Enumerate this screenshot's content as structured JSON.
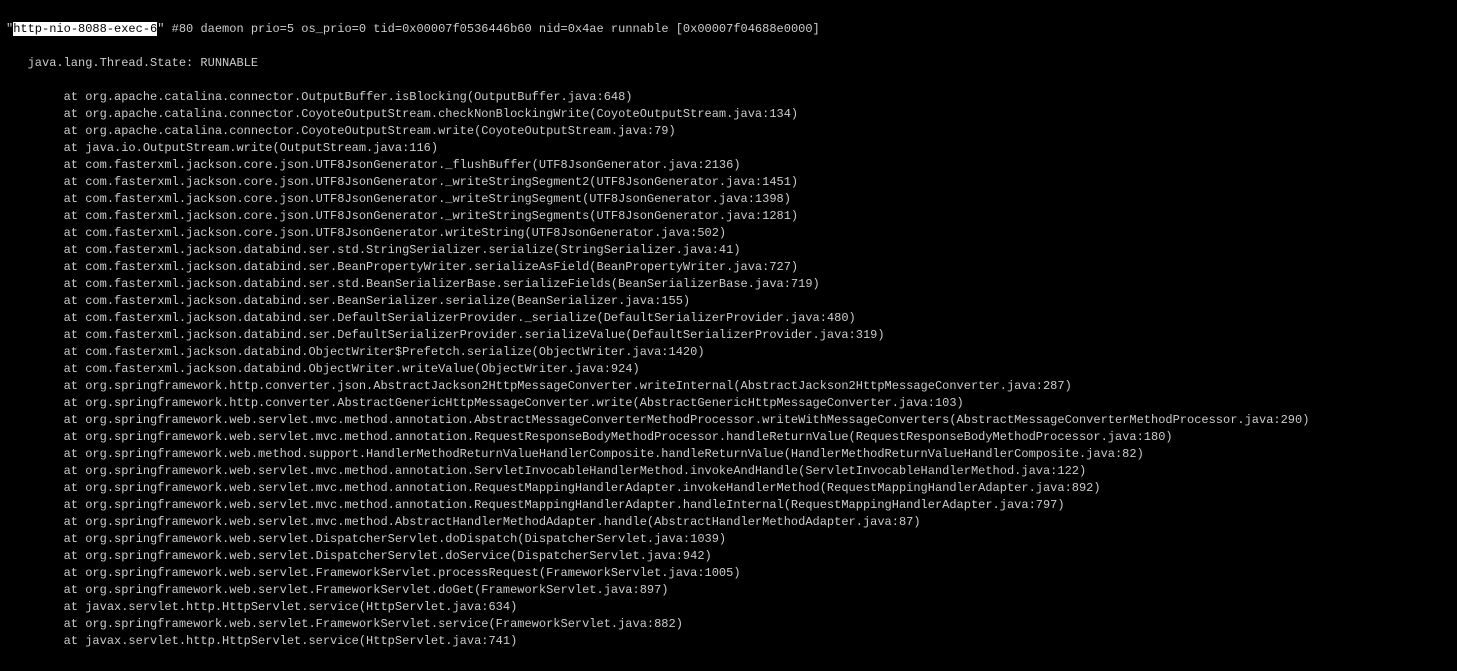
{
  "thread": {
    "quote_open": "\"",
    "name": "http-nio-8088-exec-6",
    "quote_close": "\"",
    "info": " #80 daemon prio=5 os_prio=0 tid=0x00007f0536446b60 nid=0x4ae runnable [0x00007f04688e0000]",
    "state_line": "   java.lang.Thread.State: RUNNABLE"
  },
  "frames": [
    "        at org.apache.catalina.connector.OutputBuffer.isBlocking(OutputBuffer.java:648)",
    "        at org.apache.catalina.connector.CoyoteOutputStream.checkNonBlockingWrite(CoyoteOutputStream.java:134)",
    "        at org.apache.catalina.connector.CoyoteOutputStream.write(CoyoteOutputStream.java:79)",
    "        at java.io.OutputStream.write(OutputStream.java:116)",
    "        at com.fasterxml.jackson.core.json.UTF8JsonGenerator._flushBuffer(UTF8JsonGenerator.java:2136)",
    "        at com.fasterxml.jackson.core.json.UTF8JsonGenerator._writeStringSegment2(UTF8JsonGenerator.java:1451)",
    "        at com.fasterxml.jackson.core.json.UTF8JsonGenerator._writeStringSegment(UTF8JsonGenerator.java:1398)",
    "        at com.fasterxml.jackson.core.json.UTF8JsonGenerator._writeStringSegments(UTF8JsonGenerator.java:1281)",
    "        at com.fasterxml.jackson.core.json.UTF8JsonGenerator.writeString(UTF8JsonGenerator.java:502)",
    "        at com.fasterxml.jackson.databind.ser.std.StringSerializer.serialize(StringSerializer.java:41)",
    "        at com.fasterxml.jackson.databind.ser.BeanPropertyWriter.serializeAsField(BeanPropertyWriter.java:727)",
    "        at com.fasterxml.jackson.databind.ser.std.BeanSerializerBase.serializeFields(BeanSerializerBase.java:719)",
    "        at com.fasterxml.jackson.databind.ser.BeanSerializer.serialize(BeanSerializer.java:155)",
    "        at com.fasterxml.jackson.databind.ser.DefaultSerializerProvider._serialize(DefaultSerializerProvider.java:480)",
    "        at com.fasterxml.jackson.databind.ser.DefaultSerializerProvider.serializeValue(DefaultSerializerProvider.java:319)",
    "        at com.fasterxml.jackson.databind.ObjectWriter$Prefetch.serialize(ObjectWriter.java:1420)",
    "        at com.fasterxml.jackson.databind.ObjectWriter.writeValue(ObjectWriter.java:924)",
    "        at org.springframework.http.converter.json.AbstractJackson2HttpMessageConverter.writeInternal(AbstractJackson2HttpMessageConverter.java:287)",
    "        at org.springframework.http.converter.AbstractGenericHttpMessageConverter.write(AbstractGenericHttpMessageConverter.java:103)",
    "        at org.springframework.web.servlet.mvc.method.annotation.AbstractMessageConverterMethodProcessor.writeWithMessageConverters(AbstractMessageConverterMethodProcessor.java:290)",
    "        at org.springframework.web.servlet.mvc.method.annotation.RequestResponseBodyMethodProcessor.handleReturnValue(RequestResponseBodyMethodProcessor.java:180)",
    "        at org.springframework.web.method.support.HandlerMethodReturnValueHandlerComposite.handleReturnValue(HandlerMethodReturnValueHandlerComposite.java:82)",
    "        at org.springframework.web.servlet.mvc.method.annotation.ServletInvocableHandlerMethod.invokeAndHandle(ServletInvocableHandlerMethod.java:122)",
    "        at org.springframework.web.servlet.mvc.method.annotation.RequestMappingHandlerAdapter.invokeHandlerMethod(RequestMappingHandlerAdapter.java:892)",
    "        at org.springframework.web.servlet.mvc.method.annotation.RequestMappingHandlerAdapter.handleInternal(RequestMappingHandlerAdapter.java:797)",
    "        at org.springframework.web.servlet.mvc.method.AbstractHandlerMethodAdapter.handle(AbstractHandlerMethodAdapter.java:87)",
    "        at org.springframework.web.servlet.DispatcherServlet.doDispatch(DispatcherServlet.java:1039)",
    "        at org.springframework.web.servlet.DispatcherServlet.doService(DispatcherServlet.java:942)",
    "        at org.springframework.web.servlet.FrameworkServlet.processRequest(FrameworkServlet.java:1005)",
    "        at org.springframework.web.servlet.FrameworkServlet.doGet(FrameworkServlet.java:897)",
    "        at javax.servlet.http.HttpServlet.service(HttpServlet.java:634)",
    "        at org.springframework.web.servlet.FrameworkServlet.service(FrameworkServlet.java:882)",
    "        at javax.servlet.http.HttpServlet.service(HttpServlet.java:741)"
  ]
}
